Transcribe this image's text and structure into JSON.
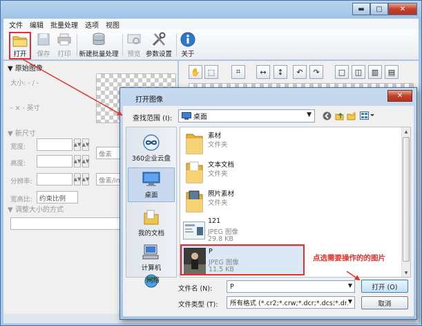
{
  "menu": [
    "文件",
    "编辑",
    "批量处理",
    "选项",
    "视图"
  ],
  "window_buttons": {
    "min": "▬",
    "max": "□",
    "close": "✕"
  },
  "toolbar": {
    "open": "打开",
    "save": "保存",
    "print": "打印",
    "batch": "新建批量处理",
    "preview": "预览",
    "settings": "参数设置",
    "about": "关于"
  },
  "left_panel": {
    "original_image": "▼ 原始图像",
    "size": "大小: - / -",
    "dims": "- × - 英寸",
    "new_size": "▼ 新尺寸",
    "width": "宽度:",
    "height": "高度:",
    "resolution": "分辨率:",
    "unit_pixel": "像素",
    "unit_pixel_in": "像素/in",
    "aspect": "宽高比:",
    "aspect_value": "约束比例",
    "resize_method": "▼ 调整大小的方式"
  },
  "dialog": {
    "title": "打开图像",
    "close": "✕",
    "look_in_label": "查找范围 (I):",
    "look_in_value": "桌面",
    "places": [
      "360企业云盘",
      "桌面",
      "我的文档",
      "计算机",
      "网络"
    ],
    "files": [
      {
        "name": "素材",
        "type": "文件夹",
        "size": ""
      },
      {
        "name": "文本文档",
        "type": "文件夹",
        "size": ""
      },
      {
        "name": "照片素材",
        "type": "文件夹",
        "size": ""
      },
      {
        "name": "121",
        "type": "JPEG 图像",
        "size": "29.8 KB"
      },
      {
        "name": "P",
        "type": "JPEG 图像",
        "size": "11.5 KB"
      }
    ],
    "annotation": "点选需要操作的的图片",
    "filename_label": "文件名 (N):",
    "filename_value": "P",
    "filetype_label": "文件类型 (T):",
    "filetype_value": "所有格式 (*.cr2;*.crw;*.dcr;*.dcs;*.dn",
    "open_button": "打开 (O)",
    "cancel_button": "取消"
  },
  "colors": {
    "accent_red": "#e0332b",
    "title_blue": "#a8c5e6"
  }
}
